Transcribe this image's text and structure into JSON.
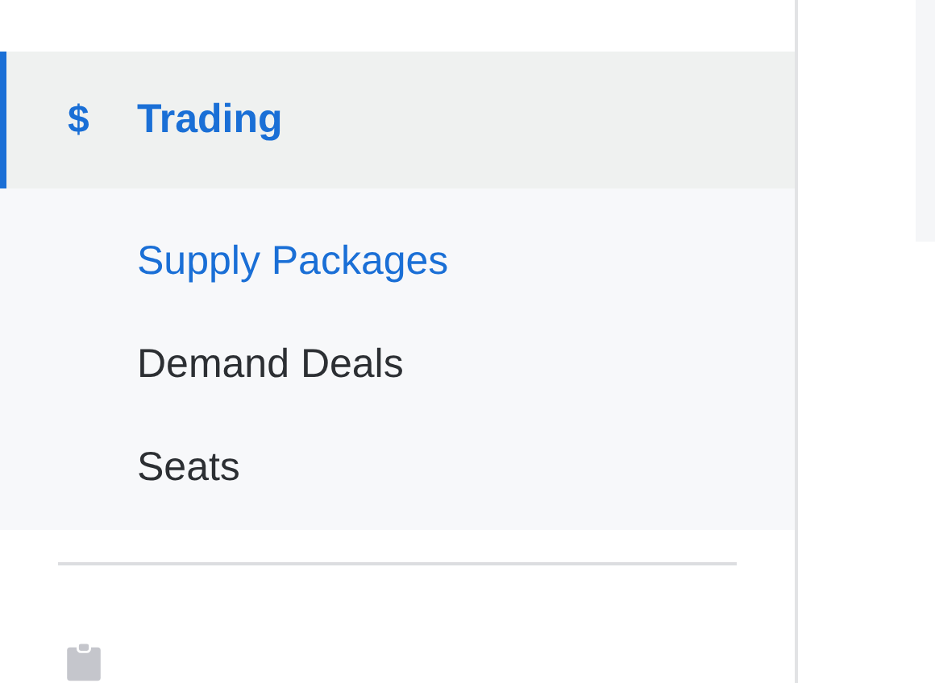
{
  "nav": {
    "icon": "$",
    "label": "Trading",
    "selected": true,
    "expanded": true,
    "children": [
      {
        "label": "Supply Packages",
        "selected": true
      },
      {
        "label": "Demand Deals",
        "selected": false
      },
      {
        "label": "Seats",
        "selected": false
      }
    ]
  }
}
